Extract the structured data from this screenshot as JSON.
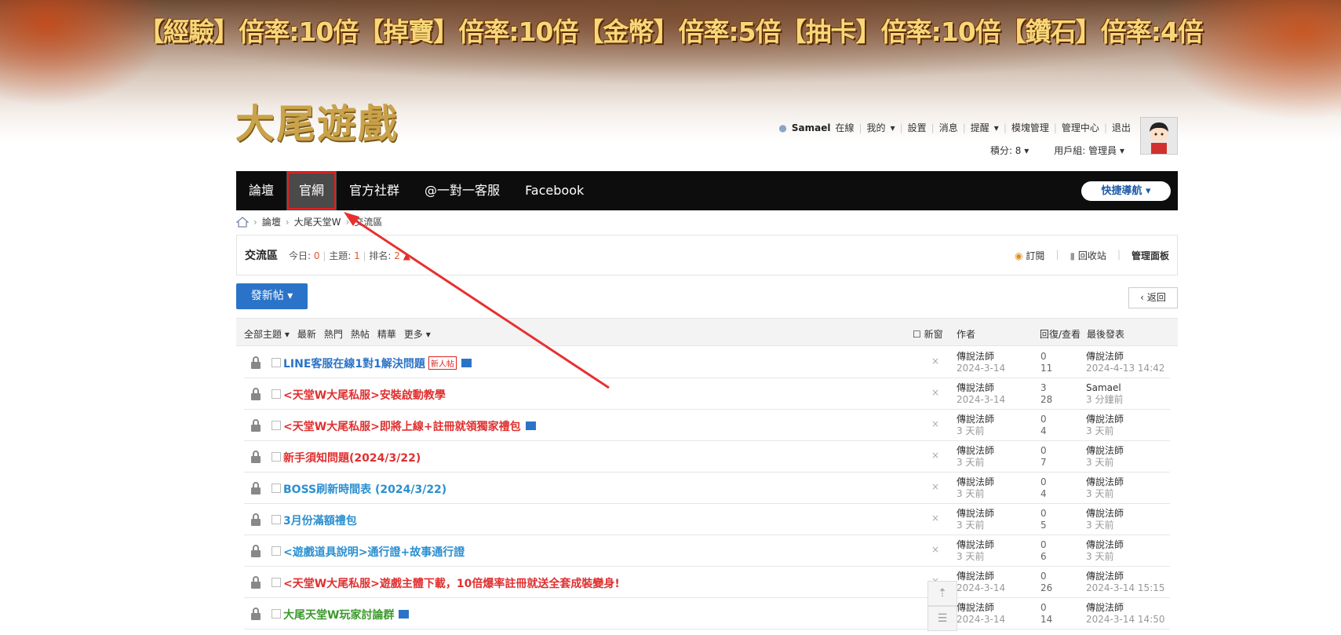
{
  "banner": {
    "rates": "【經驗】倍率:10倍【掉寶】倍率:10倍【金幣】倍率:5倍【抽卡】倍率:10倍【鑽石】倍率:4倍"
  },
  "logo": "大尾遊戲",
  "user": {
    "name": "Samael",
    "status": "在線",
    "links": [
      "我的",
      "設置",
      "消息",
      "提醒",
      "模塊管理",
      "管理中心",
      "退出"
    ],
    "points": "積分: 8",
    "group": "用戶組: 管理員"
  },
  "nav": {
    "items": [
      "論壇",
      "官網",
      "官方社群",
      "@一對一客服",
      "Facebook"
    ],
    "quick": "快捷導航"
  },
  "breadcrumb": [
    "論壇",
    "大尾天堂W",
    "交流區"
  ],
  "forum": {
    "name": "交流區",
    "today_label": "今日:",
    "today": "0",
    "topics_label": "主題:",
    "topics": "1",
    "rank_label": "排名:",
    "rank": "2",
    "subscribe": "訂閱",
    "recycle": "回收站",
    "manage": "管理面板"
  },
  "buttons": {
    "post": "發新帖 ▾",
    "back": "返回"
  },
  "list": {
    "filters": [
      "全部主題 ▾",
      "最新",
      "熱門",
      "熱帖",
      "精華",
      "更多 ▾"
    ],
    "newwin": "新窗",
    "col_author": "作者",
    "col_reply": "回復/查看",
    "col_last": "最後發表"
  },
  "threads": [
    {
      "title": "LINE客服在線1對1解決問題",
      "badge": "新人帖",
      "img": true,
      "color": "blue",
      "author": "傳說法師",
      "date": "2024-3-14",
      "replies": "0",
      "views": "11",
      "last_user": "傳說法師",
      "last_time": "2024-4-13 14:42"
    },
    {
      "title": "<天堂W大尾私服>安裝啟動教學",
      "color": "red",
      "author": "傳說法師",
      "date": "2024-3-14",
      "replies": "3",
      "views": "28",
      "last_user": "Samael",
      "last_time": "3 分鐘前"
    },
    {
      "title": "<天堂W大尾私服>即將上線+註冊就領獨家禮包",
      "img": true,
      "color": "red",
      "author": "傳說法師",
      "date": "3 天前",
      "replies": "0",
      "views": "4",
      "last_user": "傳說法師",
      "last_time": "3 天前"
    },
    {
      "title": "新手須知問題(2024/3/22)",
      "color": "red",
      "author": "傳說法師",
      "date": "3 天前",
      "replies": "0",
      "views": "7",
      "last_user": "傳說法師",
      "last_time": "3 天前"
    },
    {
      "title": "BOSS刷新時間表 (2024/3/22)",
      "color": "cyan",
      "author": "傳說法師",
      "date": "3 天前",
      "replies": "0",
      "views": "4",
      "last_user": "傳說法師",
      "last_time": "3 天前"
    },
    {
      "title": "3月份滿額禮包",
      "color": "cyan",
      "author": "傳說法師",
      "date": "3 天前",
      "replies": "0",
      "views": "5",
      "last_user": "傳說法師",
      "last_time": "3 天前"
    },
    {
      "title": "<遊戲道具說明>通行證+故事通行證",
      "color": "cyan",
      "author": "傳說法師",
      "date": "3 天前",
      "replies": "0",
      "views": "6",
      "last_user": "傳說法師",
      "last_time": "3 天前"
    },
    {
      "title": "<天堂W大尾私服>遊戲主體下載，10倍爆率註冊就送全套成裝變身!",
      "color": "red",
      "author": "傳說法師",
      "date": "2024-3-14",
      "replies": "0",
      "views": "26",
      "last_user": "傳說法師",
      "last_time": "2024-3-14 15:15"
    },
    {
      "title": "大尾天堂W玩家討論群",
      "img": true,
      "color": "green",
      "author": "傳說法師",
      "date": "2024-3-14",
      "replies": "0",
      "views": "14",
      "last_user": "傳說法師",
      "last_time": "2024-3-14 14:50"
    }
  ]
}
